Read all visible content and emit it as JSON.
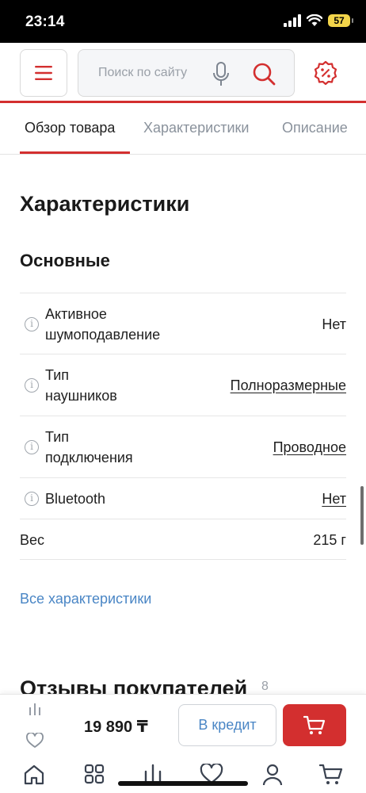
{
  "status_bar": {
    "time": "23:14",
    "battery": "57"
  },
  "header": {
    "menu_icon": "hamburger-icon",
    "search_placeholder": "Поиск по сайту",
    "mic_icon": "microphone-icon",
    "search_icon": "search-icon",
    "promo_icon": "discount-badge-icon"
  },
  "tabs": [
    {
      "label": "Обзор товара",
      "active": true
    },
    {
      "label": "Характеристики",
      "active": false
    },
    {
      "label": "Описание",
      "active": false
    }
  ],
  "specs": {
    "title": "Характеристики",
    "group_title": "Основные",
    "rows": [
      {
        "label": "Активное шумоподавление",
        "value": "Нет",
        "link": false,
        "info": true
      },
      {
        "label": "Тип наушников",
        "value": "Полноразмерные",
        "link": true,
        "info": true
      },
      {
        "label": "Тип подключения",
        "value": "Проводное",
        "link": true,
        "info": true
      },
      {
        "label": "Bluetooth",
        "value": "Нет",
        "link": true,
        "info": true
      },
      {
        "label": "Вес",
        "value": "215 г",
        "link": false,
        "info": false
      }
    ],
    "all_link": "Все характеристики"
  },
  "reviews": {
    "title": "Отзывы покупателей",
    "count": "8"
  },
  "buy_bar": {
    "price": "19 890 ₸",
    "credit_label": "В кредит",
    "cart_icon": "cart-icon",
    "compare_icon": "compare-icon",
    "favorite_icon": "heart-icon"
  },
  "bottom_nav": [
    "home-icon",
    "catalog-icon",
    "compare-icon",
    "favorites-icon",
    "profile-icon",
    "cart-icon"
  ],
  "colors": {
    "accent": "#d32f2f",
    "link": "#4a86c5",
    "muted": "#8a929c"
  }
}
